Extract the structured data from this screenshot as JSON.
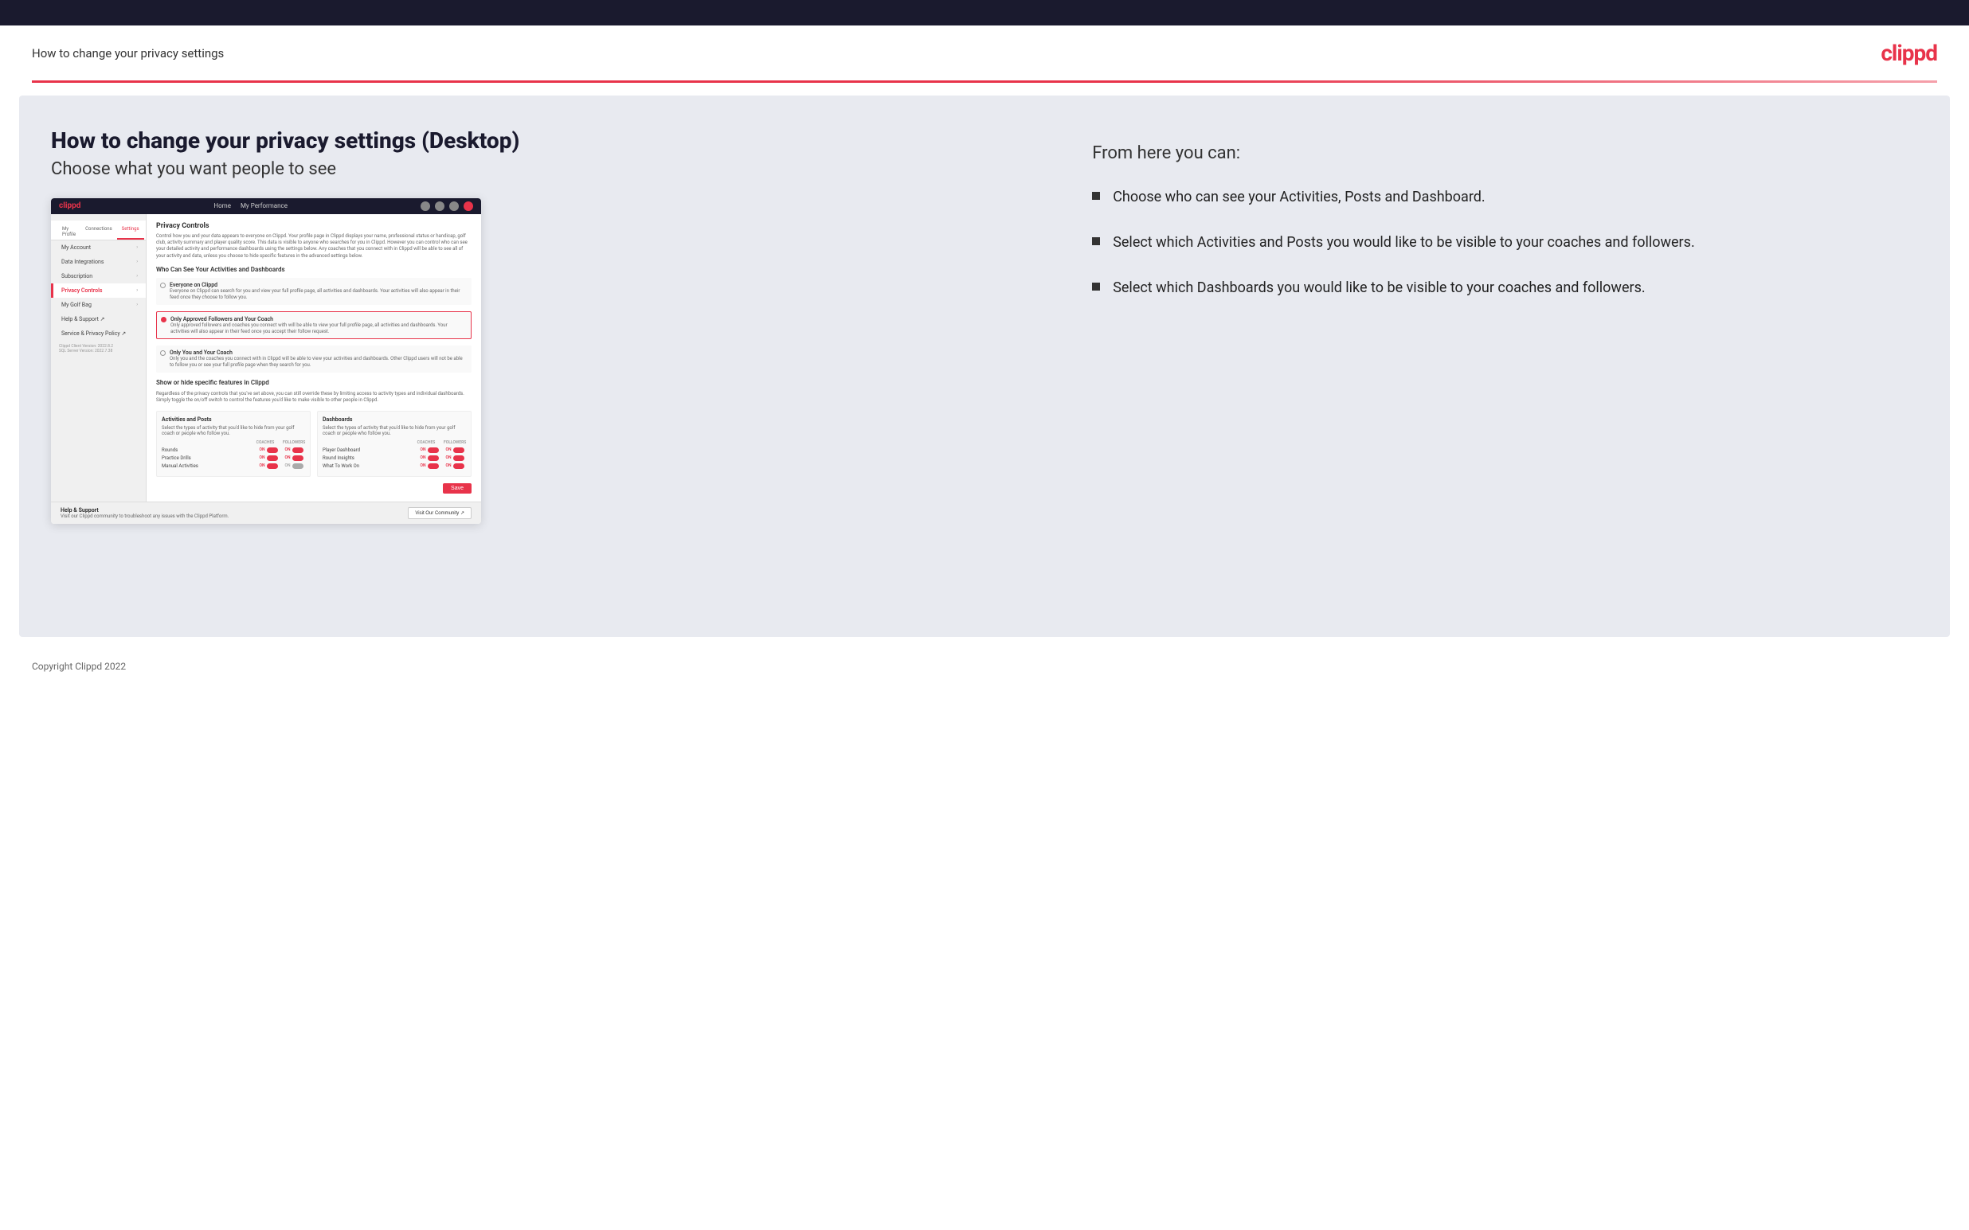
{
  "header": {
    "title": "How to change your privacy settings",
    "logo": "clippd"
  },
  "main": {
    "heading": "How to change your privacy settings (Desktop)",
    "subheading": "Choose what you want people to see",
    "screenshot": {
      "nav": {
        "logo": "clippd",
        "links": [
          "Home",
          "My Performance"
        ]
      },
      "sidebar": {
        "tabs": [
          "My Profile",
          "Connections",
          "Settings"
        ],
        "active_tab": "Settings",
        "items": [
          {
            "label": "My Account",
            "active": false
          },
          {
            "label": "Data Integrations",
            "active": false
          },
          {
            "label": "Subscription",
            "active": false
          },
          {
            "label": "Privacy Controls",
            "active": true
          },
          {
            "label": "My Golf Bag",
            "active": false
          },
          {
            "label": "Help & Support",
            "active": false
          },
          {
            "label": "Service & Privacy Policy",
            "active": false
          }
        ],
        "version": "Clippd Client Version: 2022.8.2\nSQL Server Version: 2022.7.38"
      },
      "main": {
        "section_title": "Privacy Controls",
        "section_desc": "Control how you and your data appears to everyone on Clippd. Your profile page in Clippd displays your name, professional status or handicap, golf club, activity summary and player quality score. This data is visible to anyone who searches for you in Clippd. However you can control who can see your detailed activity and performance dashboards using the settings below. Any coaches that you connect with in Clippd will be able to see all of your activity and data, unless you choose to hide specific features in the advanced settings below.",
        "who_can_see_title": "Who Can See Your Activities and Dashboards",
        "radio_options": [
          {
            "label": "Everyone on Clippd",
            "desc": "Everyone on Clippd can search for you and view your full profile page, all activities and dashboards. Your activities will also appear in their feed once they choose to follow you.",
            "selected": false
          },
          {
            "label": "Only Approved Followers and Your Coach",
            "desc": "Only approved followers and coaches you connect with will be able to view your full profile page, all activities and dashboards. Your activities will also appear in their feed once you accept their follow request.",
            "selected": true
          },
          {
            "label": "Only You and Your Coach",
            "desc": "Only you and the coaches you connect with in Clippd will be able to view your activities and dashboards. Other Clippd users will not be able to follow you or see your full profile page when they search for you.",
            "selected": false
          }
        ],
        "show_hide_title": "Show or hide specific features in Clippd",
        "show_hide_desc": "Regardless of the privacy controls that you've set above, you can still override these by limiting access to activity types and individual dashboards. Simply toggle the on/off switch to control the features you'd like to make visible to other people in Clippd.",
        "activities_posts": {
          "title": "Activities and Posts",
          "desc": "Select the types of activity that you'd like to hide from your golf coach or people who follow you.",
          "columns": [
            "COACHES",
            "FOLLOWERS"
          ],
          "rows": [
            {
              "label": "Rounds",
              "coaches": "ON",
              "followers": "ON"
            },
            {
              "label": "Practice Drills",
              "coaches": "ON",
              "followers": "ON"
            },
            {
              "label": "Manual Activities",
              "coaches": "ON",
              "followers": "OFF"
            }
          ]
        },
        "dashboards": {
          "title": "Dashboards",
          "desc": "Select the types of activity that you'd like to hide from your golf coach or people who follow you.",
          "columns": [
            "COACHES",
            "FOLLOWERS"
          ],
          "rows": [
            {
              "label": "Player Dashboard",
              "coaches": "ON",
              "followers": "ON"
            },
            {
              "label": "Round Insights",
              "coaches": "ON",
              "followers": "ON"
            },
            {
              "label": "What To Work On",
              "coaches": "ON",
              "followers": "ON"
            }
          ]
        },
        "save_label": "Save",
        "help": {
          "title": "Help & Support",
          "desc": "Visit our Clippd community to troubleshoot any issues with the Clippd Platform.",
          "button": "Visit Our Community"
        }
      }
    },
    "right_panel": {
      "from_here_title": "From here you can:",
      "bullets": [
        "Choose who can see your Activities, Posts and Dashboard.",
        "Select which Activities and Posts you would like to be visible to your coaches and followers.",
        "Select which Dashboards you would like to be visible to your coaches and followers."
      ]
    }
  },
  "footer": {
    "copyright": "Copyright Clippd 2022"
  }
}
